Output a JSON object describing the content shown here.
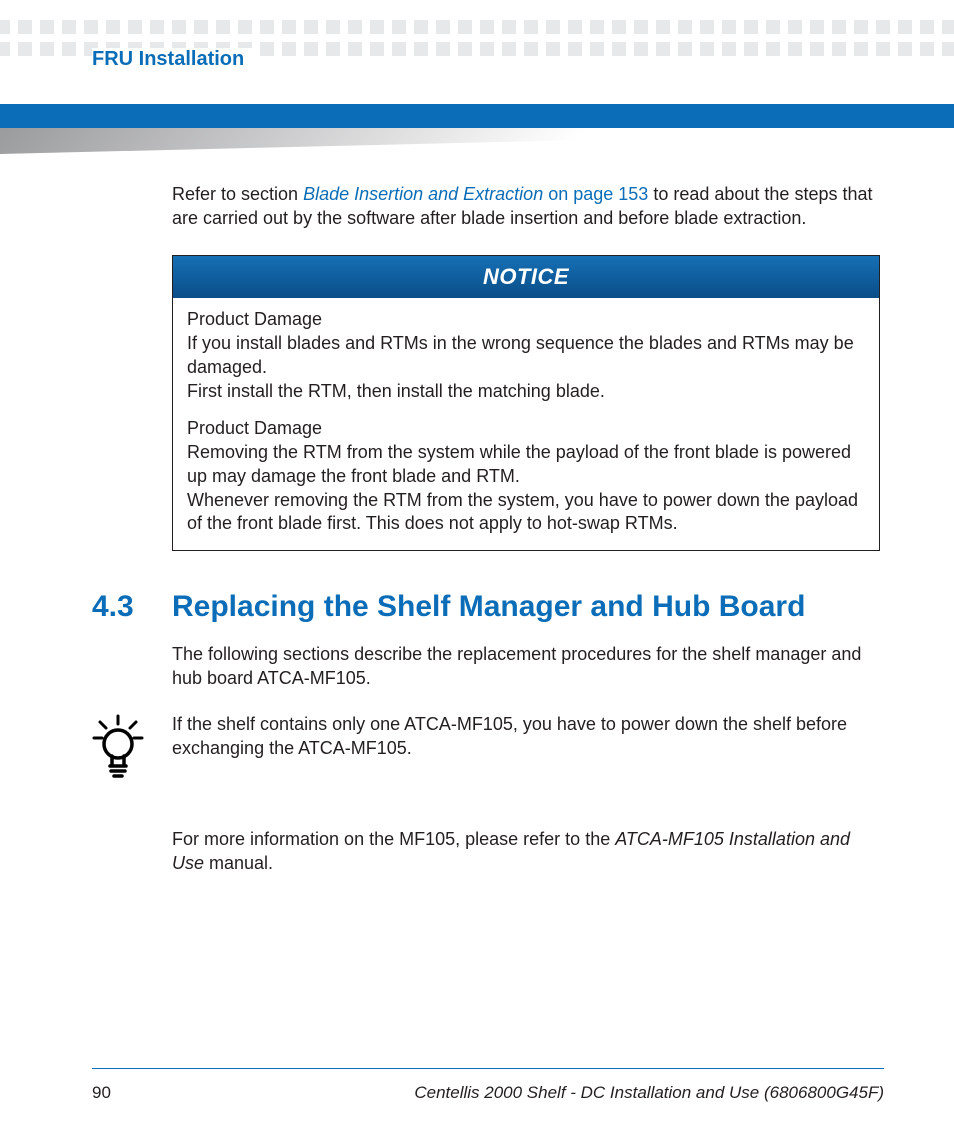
{
  "header": {
    "running_head": "FRU Installation"
  },
  "intro": {
    "prefix": "Refer to section ",
    "xref_title": "Blade Insertion and Extraction",
    "xref_suffix": " on page 153",
    "tail": " to read about the steps that are carried out by the software after blade insertion and before blade extraction."
  },
  "notice": {
    "label": "NOTICE",
    "block1_title": "Product Damage",
    "block1_line1": "If you install blades and RTMs in the wrong sequence the blades and RTMs may be damaged.",
    "block1_line2": "First install the RTM, then install the matching blade.",
    "block2_title": "Product Damage",
    "block2_line1": "Removing the RTM from the system while the payload of the front blade is powered up may damage the front blade and RTM.",
    "block2_line2": "Whenever removing the RTM from the system, you have to power down the payload of the front blade first. This does not apply to hot-swap RTMs."
  },
  "section": {
    "number": "4.3",
    "title": "Replacing the Shelf Manager and Hub Board",
    "intro": "The following sections describe the replacement procedures for the shelf manager and hub board ATCA-MF105.",
    "tip": "If the shelf contains only one ATCA-MF105, you have to power down the shelf before exchanging the ATCA-MF105.",
    "more_prefix": "For more information on the MF105, please refer to the ",
    "more_ref": "ATCA-MF105 Installation and Use",
    "more_suffix": " manual."
  },
  "footer": {
    "page": "90",
    "doc": "Centellis 2000 Shelf - DC Installation and Use (6806800G45F)"
  }
}
